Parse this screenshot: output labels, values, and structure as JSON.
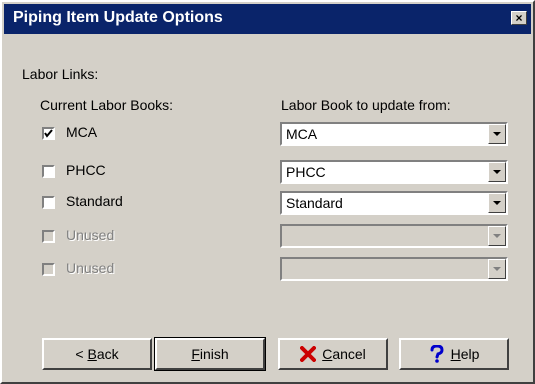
{
  "window": {
    "title": "Piping Item Update Options",
    "close_symbol": "×"
  },
  "section_label": "Labor Links:",
  "left_header": "Current Labor Books:",
  "right_header": "Labor Book to update from:",
  "rows": [
    {
      "label": "MCA",
      "checked": true,
      "enabled": true,
      "combo_value": "MCA"
    },
    {
      "label": "PHCC",
      "checked": false,
      "enabled": true,
      "combo_value": "PHCC"
    },
    {
      "label": "Standard",
      "checked": false,
      "enabled": true,
      "combo_value": "Standard"
    },
    {
      "label": "Unused",
      "checked": false,
      "enabled": false,
      "combo_value": ""
    },
    {
      "label": "Unused",
      "checked": false,
      "enabled": false,
      "combo_value": ""
    }
  ],
  "buttons": {
    "back": {
      "prefix": "< ",
      "mnemonic": "B",
      "rest": "ack"
    },
    "finish": {
      "mnemonic": "F",
      "rest": "inish"
    },
    "cancel": {
      "mnemonic": "C",
      "rest": "ancel",
      "icon": "x-icon",
      "icon_color": "#cc0000"
    },
    "help": {
      "mnemonic": "H",
      "rest": "elp",
      "icon": "question-icon",
      "icon_color": "#0000cc"
    }
  }
}
